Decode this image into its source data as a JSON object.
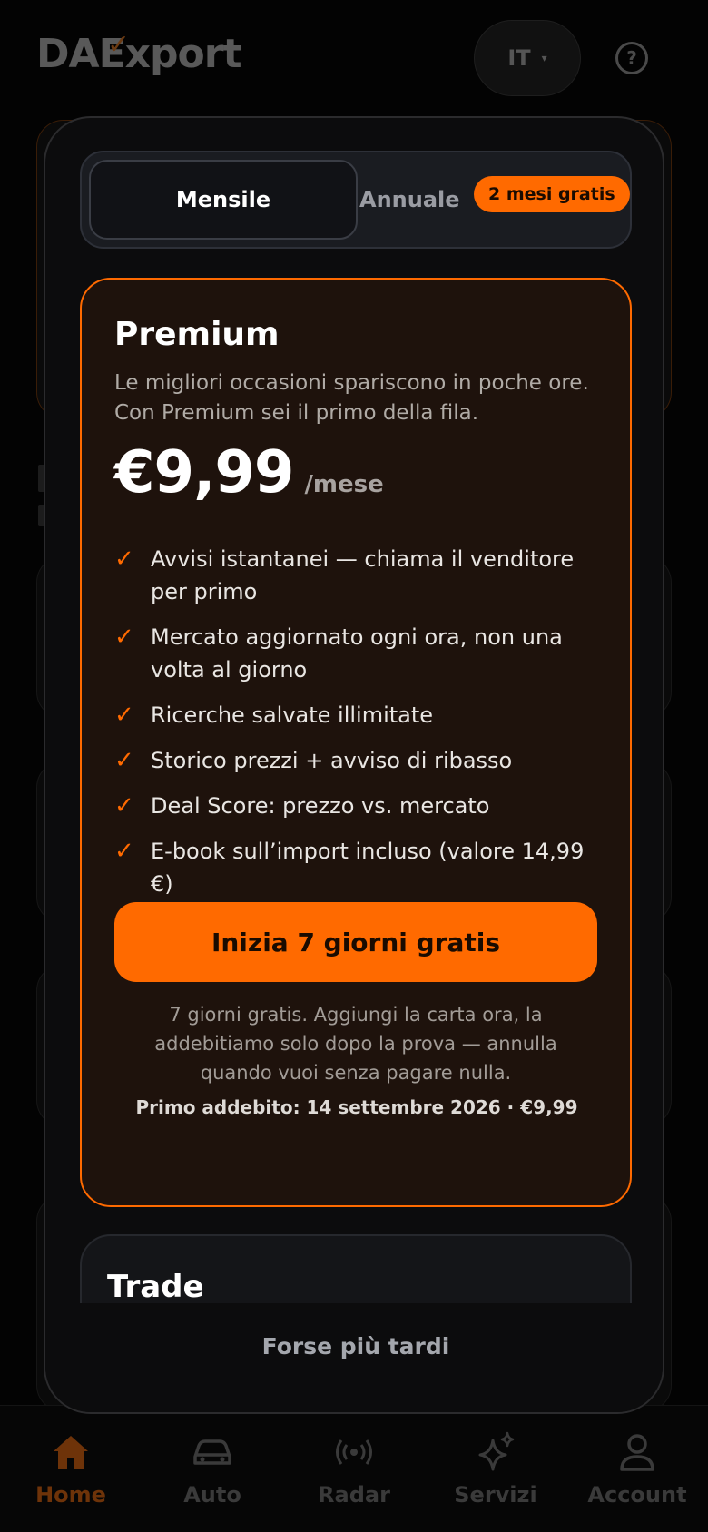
{
  "header": {
    "logo_text": "DAExport",
    "logo_mark": "✓",
    "language": "IT",
    "language_caret": "▾",
    "help_glyph": "?"
  },
  "modal": {
    "billing_toggle": {
      "monthly_label": "Mensile",
      "annual_label": "Annuale",
      "annual_badge": "2 mesi gratis",
      "selected": "monthly"
    },
    "plan": {
      "name": "Premium",
      "description": "Le migliori occasioni spariscono in poche ore. Con Premium sei il primo della fila.",
      "price": "€9,99",
      "period": "/mese",
      "check_glyph": "✓",
      "features": [
        "Avvisi istantanei — chiama il venditore per primo",
        "Mercato aggiornato ogni ora, non una volta al giorno",
        "Ricerche salvate illimitate",
        "Storico prezzi + avviso di ribasso",
        "Deal Score: prezzo vs. mercato",
        "E-book sull’import incluso (valore 14,99 €)"
      ],
      "cta_label": "Inizia 7 giorni gratis",
      "fine_print": "7 giorni gratis. Aggiungi la carta ora, la addebitiamo solo dopo la prova — annulla quando vuoi senza pagare nulla.",
      "first_charge": "Primo addebito: 14 settembre 2026 · €9,99"
    },
    "secondary_plan": {
      "name": "Trade"
    },
    "dismiss_label": "Forse più tardi"
  },
  "bottom_nav": {
    "items": [
      {
        "label": "Home",
        "icon": "home-icon",
        "active": true
      },
      {
        "label": "Auto",
        "icon": "car-icon",
        "active": false
      },
      {
        "label": "Radar",
        "icon": "radar-icon",
        "active": false
      },
      {
        "label": "Servizi",
        "icon": "sparkles-icon",
        "active": false
      },
      {
        "label": "Account",
        "icon": "user-icon",
        "active": false
      }
    ]
  },
  "colors": {
    "accent": "#ff6a00",
    "card_bg": "#1e120c",
    "modal_bg": "#0c0c0d"
  }
}
